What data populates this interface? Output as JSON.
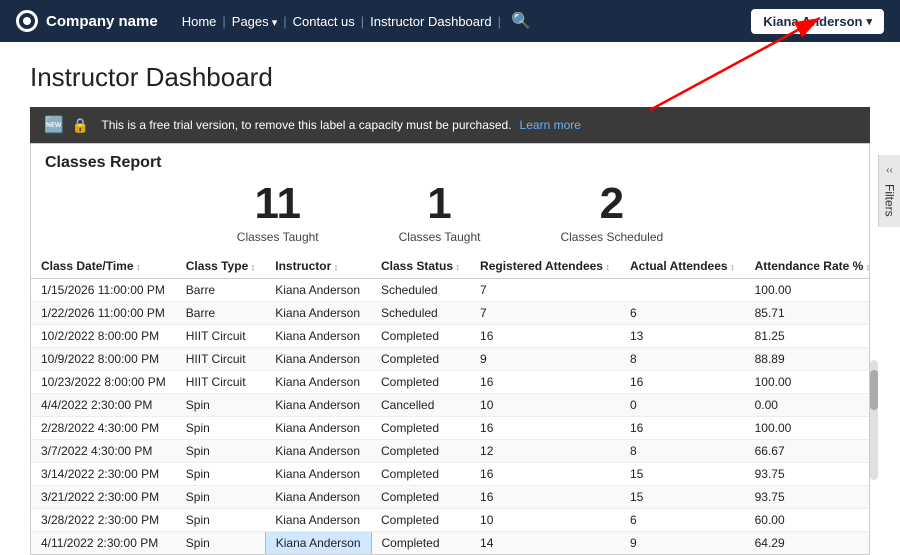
{
  "nav": {
    "brand": "Company name",
    "links": [
      {
        "label": "Home",
        "id": "home"
      },
      {
        "label": "Pages",
        "id": "pages",
        "dropdown": true
      },
      {
        "label": "Contact us",
        "id": "contact"
      },
      {
        "label": "Instructor Dashboard",
        "id": "instructor-dashboard"
      }
    ],
    "user": "Kiana Anderson"
  },
  "page": {
    "title": "Instructor Dashboard"
  },
  "banner": {
    "text": "This is a free trial version, to remove this label a capacity must be purchased.",
    "link_text": "Learn more"
  },
  "report": {
    "title": "Classes Report",
    "stats": [
      {
        "number": "11",
        "label": "Classes Taught"
      },
      {
        "number": "1",
        "label": "Classes Taught"
      },
      {
        "number": "2",
        "label": "Classes Scheduled"
      }
    ],
    "columns": [
      "Class Date/Time",
      "Class Type",
      "Instructor",
      "Class Status",
      "Registered Attendees",
      "Actual Attendees",
      "Attendance Rate %"
    ],
    "rows": [
      [
        "1/15/2026 11:00:00 PM",
        "Barre",
        "Kiana Anderson",
        "Scheduled",
        "7",
        "",
        "100.00"
      ],
      [
        "1/22/2026 11:00:00 PM",
        "Barre",
        "Kiana Anderson",
        "Scheduled",
        "7",
        "6",
        "85.71"
      ],
      [
        "10/2/2022 8:00:00 PM",
        "HIIT Circuit",
        "Kiana Anderson",
        "Completed",
        "16",
        "13",
        "81.25"
      ],
      [
        "10/9/2022 8:00:00 PM",
        "HIIT Circuit",
        "Kiana Anderson",
        "Completed",
        "9",
        "8",
        "88.89"
      ],
      [
        "10/23/2022 8:00:00 PM",
        "HIIT Circuit",
        "Kiana Anderson",
        "Completed",
        "16",
        "16",
        "100.00"
      ],
      [
        "4/4/2022 2:30:00 PM",
        "Spin",
        "Kiana Anderson",
        "Cancelled",
        "10",
        "0",
        "0.00"
      ],
      [
        "2/28/2022 4:30:00 PM",
        "Spin",
        "Kiana Anderson",
        "Completed",
        "16",
        "16",
        "100.00"
      ],
      [
        "3/7/2022 4:30:00 PM",
        "Spin",
        "Kiana Anderson",
        "Completed",
        "12",
        "8",
        "66.67"
      ],
      [
        "3/14/2022 2:30:00 PM",
        "Spin",
        "Kiana Anderson",
        "Completed",
        "16",
        "15",
        "93.75"
      ],
      [
        "3/21/2022 2:30:00 PM",
        "Spin",
        "Kiana Anderson",
        "Completed",
        "16",
        "15",
        "93.75"
      ],
      [
        "3/28/2022 2:30:00 PM",
        "Spin",
        "Kiana Anderson",
        "Completed",
        "10",
        "6",
        "60.00"
      ],
      [
        "4/11/2022 2:30:00 PM",
        "Spin",
        "Kiana Anderson",
        "Completed",
        "14",
        "9",
        "64.29"
      ]
    ]
  },
  "filters": {
    "label": "Filters"
  }
}
